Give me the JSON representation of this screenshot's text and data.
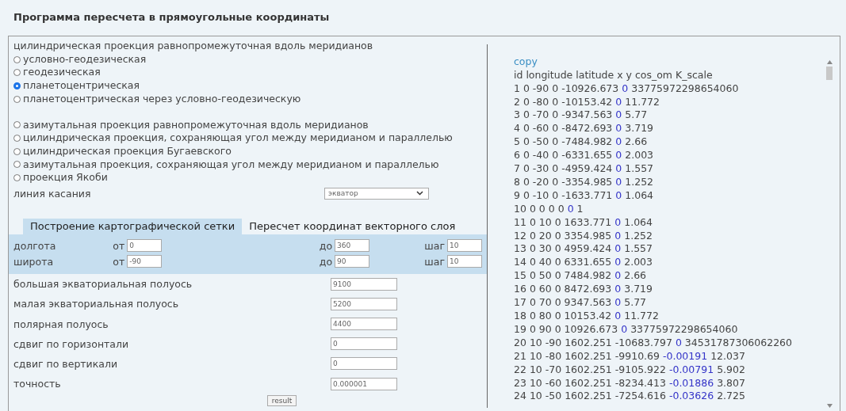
{
  "title": "Программа пересчета в прямоугольные координаты",
  "projection_groups": [
    {
      "title": "цилиндрическая проекция равнопромежуточная вдоль меридианов",
      "options": [
        {
          "label": "условно-геодезическая",
          "selected": false
        },
        {
          "label": "геодезическая",
          "selected": false
        },
        {
          "label": "планетоцентрическая",
          "selected": true
        },
        {
          "label": "планетоцентрическая через условно-геодезическую",
          "selected": false
        }
      ]
    },
    {
      "options": [
        {
          "label": "азимутальная проекция равнопромежуточная вдоль меридианов",
          "selected": false
        },
        {
          "label": "цилиндрическая проекция, сохраняющая угол между меридианом и параллелью",
          "selected": false
        },
        {
          "label": "цилиндрическая проекция Бугаевского",
          "selected": false
        },
        {
          "label": "азимутальная проекция, сохраняющая угол между меридианом и параллелью",
          "selected": false
        },
        {
          "label": "проекция Якоби",
          "selected": false
        }
      ]
    }
  ],
  "tangent_line": {
    "label": "линия касания",
    "value": "экватор"
  },
  "tabs": [
    {
      "label": "Построение картографической сетки",
      "selected": true
    },
    {
      "label": "Пересчет координат векторного слоя",
      "selected": false
    }
  ],
  "grid_ranges": [
    {
      "label": "долгота",
      "from_label": "от",
      "from": "0",
      "to_label": "до",
      "to": "360",
      "step_label": "шаг",
      "step": "10"
    },
    {
      "label": "широта",
      "from_label": "от",
      "from": "-90",
      "to_label": "до",
      "to": "90",
      "step_label": "шаг",
      "step": "10"
    }
  ],
  "parameters": [
    {
      "label": "большая экваториальная полуось",
      "value": "9100"
    },
    {
      "label": "малая экваториальная полуось",
      "value": "5200"
    },
    {
      "label": "полярная полуось",
      "value": "4400"
    },
    {
      "label": "сдвиг по горизонтали",
      "value": "0"
    },
    {
      "label": "сдвиг по вертикали",
      "value": "0"
    },
    {
      "label": "точность",
      "value": "0.000001"
    }
  ],
  "result_button": "result",
  "output": {
    "copy_link": "copy",
    "header": "id longitude latitude x y cos_om K_scale",
    "rows": [
      {
        "before": "1 0 -90 0 -10926.673",
        "cos_om": "0",
        "after": "33775972298654060"
      },
      {
        "before": "2 0 -80 0 -10153.42",
        "cos_om": "0",
        "after": "11.772"
      },
      {
        "before": "3 0 -70 0 -9347.563",
        "cos_om": "0",
        "after": "5.77"
      },
      {
        "before": "4 0 -60 0 -8472.693",
        "cos_om": "0",
        "after": "3.719"
      },
      {
        "before": "5 0 -50 0 -7484.982",
        "cos_om": "0",
        "after": "2.66"
      },
      {
        "before": "6 0 -40 0 -6331.655",
        "cos_om": "0",
        "after": "2.003"
      },
      {
        "before": "7 0 -30 0 -4959.424",
        "cos_om": "0",
        "after": "1.557"
      },
      {
        "before": "8 0 -20 0 -3354.985",
        "cos_om": "0",
        "after": "1.252"
      },
      {
        "before": "9 0 -10 0 -1633.771",
        "cos_om": "0",
        "after": "1.064"
      },
      {
        "before": "10 0 0 0 0",
        "cos_om": "0",
        "after": "1"
      },
      {
        "before": "11 0 10 0 1633.771",
        "cos_om": "0",
        "after": "1.064"
      },
      {
        "before": "12 0 20 0 3354.985",
        "cos_om": "0",
        "after": "1.252"
      },
      {
        "before": "13 0 30 0 4959.424",
        "cos_om": "0",
        "after": "1.557"
      },
      {
        "before": "14 0 40 0 6331.655",
        "cos_om": "0",
        "after": "2.003"
      },
      {
        "before": "15 0 50 0 7484.982",
        "cos_om": "0",
        "after": "2.66"
      },
      {
        "before": "16 0 60 0 8472.693",
        "cos_om": "0",
        "after": "3.719"
      },
      {
        "before": "17 0 70 0 9347.563",
        "cos_om": "0",
        "after": "5.77"
      },
      {
        "before": "18 0 80 0 10153.42",
        "cos_om": "0",
        "after": "11.772"
      },
      {
        "before": "19 0 90 0 10926.673",
        "cos_om": "0",
        "after": "33775972298654060"
      },
      {
        "before": "20 10 -90 1602.251 -10683.797",
        "cos_om": "0",
        "after": "34531787306062260"
      },
      {
        "before": "21 10 -80 1602.251 -9910.69",
        "cos_om": "-0.00191",
        "after": "12.037"
      },
      {
        "before": "22 10 -70 1602.251 -9105.922",
        "cos_om": "-0.00791",
        "after": "5.902"
      },
      {
        "before": "23 10 -60 1602.251 -8234.413",
        "cos_om": "-0.01886",
        "after": "3.807"
      },
      {
        "before": "24 10 -50 1602.251 -7254.616",
        "cos_om": "-0.03626",
        "after": "2.725"
      }
    ]
  }
}
